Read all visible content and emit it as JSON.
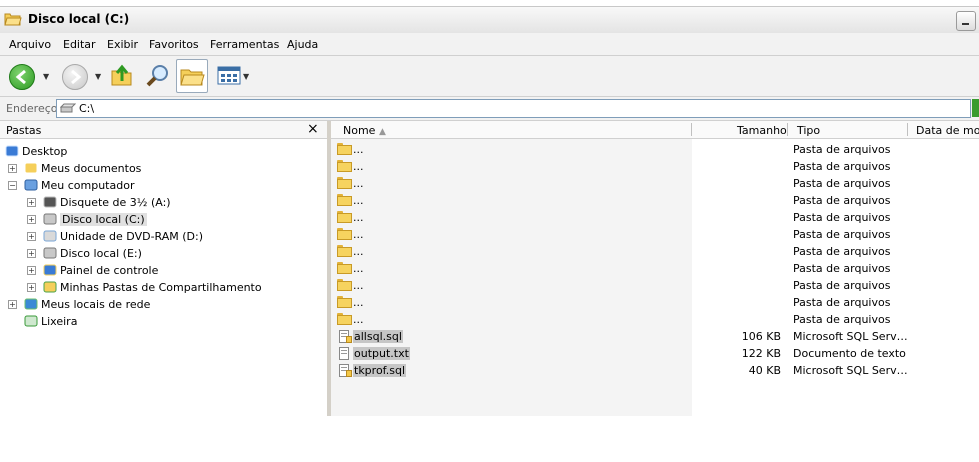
{
  "window": {
    "title": "Disco local (C:)"
  },
  "menu": [
    "Arquivo",
    "Editar",
    "Exibir",
    "Favoritos",
    "Ferramentas",
    "Ajuda"
  ],
  "address": {
    "label": "Endereço",
    "value": "C:\\"
  },
  "folders_pane": {
    "title": "Pastas",
    "close": "×",
    "tree": [
      {
        "label": "Desktop",
        "icon": "desktop-icon",
        "level": 0,
        "expander": ""
      },
      {
        "label": "Meus documentos",
        "icon": "my-documents-icon",
        "level": 1,
        "expander": "+"
      },
      {
        "label": "Meu computador",
        "icon": "my-computer-icon",
        "level": 1,
        "expander": "-"
      },
      {
        "label": "Disquete de 3½ (A:)",
        "icon": "floppy-icon",
        "level": 2,
        "expander": "+"
      },
      {
        "label": "Disco local (C:)",
        "icon": "hard-disk-icon",
        "level": 2,
        "expander": "+",
        "selected": true
      },
      {
        "label": "Unidade de DVD-RAM (D:)",
        "icon": "dvd-icon",
        "level": 2,
        "expander": "+"
      },
      {
        "label": "Disco local (E:)",
        "icon": "hard-disk-icon",
        "level": 2,
        "expander": "+"
      },
      {
        "label": "Painel de controle",
        "icon": "control-panel-icon",
        "level": 2,
        "expander": "+"
      },
      {
        "label": "Minhas Pastas de Compartilhamento",
        "icon": "shared-folders-icon",
        "level": 2,
        "expander": "+"
      },
      {
        "label": "Meus locais de rede",
        "icon": "network-places-icon",
        "level": 1,
        "expander": "+"
      },
      {
        "label": "Lixeira",
        "icon": "recycle-bin-icon",
        "level": 1,
        "expander": ""
      }
    ]
  },
  "file_list": {
    "columns": {
      "name": "Nome",
      "size": "Tamanho",
      "type": "Tipo",
      "date": "Data de modi"
    },
    "rows": [
      {
        "name": "...",
        "size": "",
        "type": "Pasta de arquivos",
        "icon": "folder-icon"
      },
      {
        "name": "...",
        "size": "",
        "type": "Pasta de arquivos",
        "icon": "folder-icon"
      },
      {
        "name": "...",
        "size": "",
        "type": "Pasta de arquivos",
        "icon": "folder-icon"
      },
      {
        "name": "...",
        "size": "",
        "type": "Pasta de arquivos",
        "icon": "folder-icon"
      },
      {
        "name": "...",
        "size": "",
        "type": "Pasta de arquivos",
        "icon": "folder-icon"
      },
      {
        "name": "...",
        "size": "",
        "type": "Pasta de arquivos",
        "icon": "folder-icon"
      },
      {
        "name": "...",
        "size": "",
        "type": "Pasta de arquivos",
        "icon": "folder-icon"
      },
      {
        "name": "...",
        "size": "",
        "type": "Pasta de arquivos",
        "icon": "folder-icon"
      },
      {
        "name": "...",
        "size": "",
        "type": "Pasta de arquivos",
        "icon": "folder-icon"
      },
      {
        "name": "...",
        "size": "",
        "type": "Pasta de arquivos",
        "icon": "folder-icon"
      },
      {
        "name": "...",
        "size": "",
        "type": "Pasta de arquivos",
        "icon": "folder-icon"
      },
      {
        "name": "allsql.sql",
        "size": "106 KB",
        "type": "Microsoft SQL Serv…",
        "icon": "sql-file-icon",
        "highlighted": true
      },
      {
        "name": "output.txt",
        "size": "122 KB",
        "type": "Documento de texto",
        "icon": "text-file-icon",
        "highlighted": true
      },
      {
        "name": "tkprof.sql",
        "size": "40 KB",
        "type": "Microsoft SQL Serv…",
        "icon": "sql-file-icon",
        "highlighted": true
      }
    ]
  }
}
